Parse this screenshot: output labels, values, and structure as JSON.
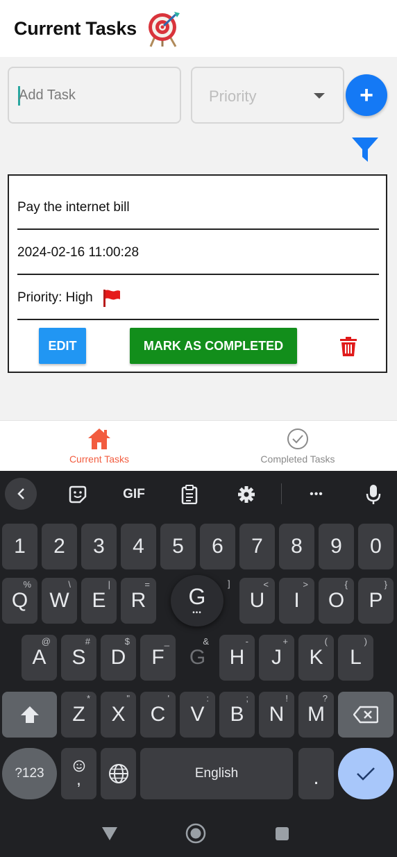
{
  "header": {
    "title": "Current Tasks",
    "title_icon": "target-dart-icon"
  },
  "form": {
    "task_placeholder": "Add Task",
    "priority_placeholder": "Priority",
    "add_button_label": "+",
    "filter_icon": "filter-icon"
  },
  "tasks": [
    {
      "title": "Pay the internet bill",
      "datetime": "2024-02-16 11:00:28",
      "priority_text": "Priority: High",
      "priority_flag_color": "#e51a1a",
      "edit_label": "EDIT",
      "complete_label": "MARK AS COMPLETED"
    }
  ],
  "tabs": [
    {
      "label": "Current Tasks",
      "icon": "home-icon",
      "active": true,
      "color": "#f25c3f"
    },
    {
      "label": "Completed Tasks",
      "icon": "check-circle-icon",
      "active": false,
      "color": "#8a8a8a"
    }
  ],
  "keyboard": {
    "toolbar": [
      "back",
      "sticker",
      "GIF",
      "clipboard",
      "settings",
      "more",
      "mic"
    ],
    "gif_label": "GIF",
    "more_label": "•••",
    "row_numbers": [
      "1",
      "2",
      "3",
      "4",
      "5",
      "6",
      "7",
      "8",
      "9",
      "0"
    ],
    "row_q": [
      {
        "k": "Q",
        "h": "%"
      },
      {
        "k": "W",
        "h": "\\"
      },
      {
        "k": "E",
        "h": "|"
      },
      {
        "k": "R",
        "h": "="
      },
      {
        "k": "G",
        "h": ""
      },
      {
        "k": "U",
        "h": "<"
      },
      {
        "k": "I",
        "h": ">"
      },
      {
        "k": "O",
        "h": "{"
      },
      {
        "k": "P",
        "h": "}"
      }
    ],
    "row_q_bracket": "]",
    "popup_key": "G",
    "popup_dots": "•••",
    "row_a": [
      {
        "k": "A",
        "h": "@"
      },
      {
        "k": "S",
        "h": "#"
      },
      {
        "k": "D",
        "h": "$"
      },
      {
        "k": "F",
        "h": "_"
      },
      {
        "k": "G",
        "h": "&"
      },
      {
        "k": "H",
        "h": "-"
      },
      {
        "k": "J",
        "h": "+"
      },
      {
        "k": "K",
        "h": "("
      },
      {
        "k": "L",
        "h": ")"
      }
    ],
    "row_z": [
      {
        "k": "Z",
        "h": "*"
      },
      {
        "k": "X",
        "h": "\""
      },
      {
        "k": "C",
        "h": "'"
      },
      {
        "k": "V",
        "h": ":"
      },
      {
        "k": "B",
        "h": ";"
      },
      {
        "k": "N",
        "h": "!"
      },
      {
        "k": "M",
        "h": "?"
      }
    ],
    "symbols_label": "?123",
    "emoji_comma": ",",
    "space_label": "English",
    "period_label": ".",
    "accent_color": "#a8c7fa"
  },
  "system_nav": [
    "back-triangle-icon",
    "home-circle-icon",
    "recents-square-icon"
  ]
}
